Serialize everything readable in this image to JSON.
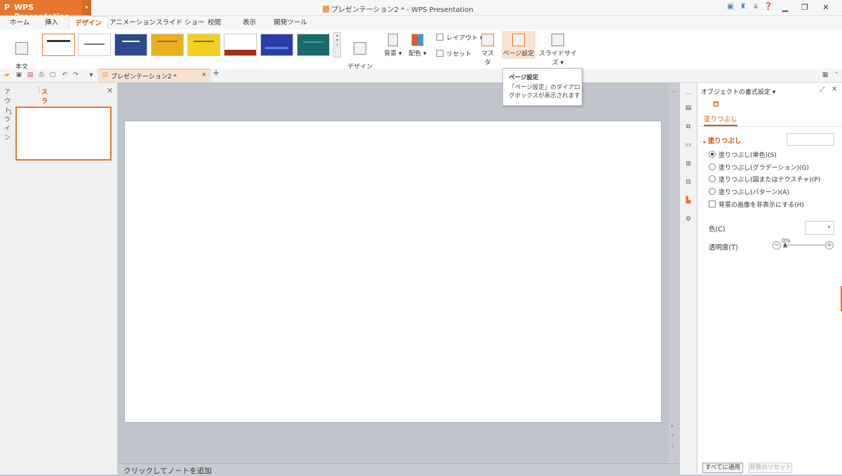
{
  "app": {
    "name": "WPS Presentation",
    "logo": "P",
    "dropdown": "▾"
  },
  "window": {
    "title": "プレゼンテーション2 * - WPS Presentation",
    "min": "▁",
    "restore": "❐",
    "close": "✕"
  },
  "titlebar_icons": [
    "skin-icon",
    "shirt-icon",
    "user-icon",
    "help-icon"
  ],
  "menu_tabs": [
    "ホーム",
    "挿入",
    "デザイン",
    "アニメーション",
    "スライド ショー",
    "校閲",
    "表示",
    "開発ツール"
  ],
  "active_tab": "デザイン",
  "ribbon": {
    "body_template": "本文\nテンプレート",
    "design_template": "デザイン\nテンプレート",
    "background": "背景",
    "color_scheme": "配色",
    "layout": "レイアウト",
    "reset": "リセット",
    "master": "マスタ",
    "page_setup": "ページ設定",
    "slide_size": "スライドサイズ"
  },
  "theme_thumbnails": [
    {
      "name": "theme-1",
      "bg": "#ffffff",
      "accent": "#333333"
    },
    {
      "name": "theme-2",
      "bg": "#ffffff",
      "accent": "#666666"
    },
    {
      "name": "theme-3",
      "bg": "#2c4a8c",
      "accent": "#ffffff"
    },
    {
      "name": "theme-4",
      "bg": "#e8b020",
      "accent": "#c05a10"
    },
    {
      "name": "theme-5",
      "bg": "#f2d020",
      "accent": "#807010"
    },
    {
      "name": "theme-6",
      "bg": "#ffffff",
      "accent": "#a03010"
    },
    {
      "name": "theme-7",
      "bg": "#2a3ea8",
      "accent": "#6080e0"
    },
    {
      "name": "theme-8",
      "bg": "#1a6a6a",
      "accent": "#40a0a0"
    }
  ],
  "tooltip": {
    "title": "ページ設定",
    "body": "「ページ設定」のダイアログボックスが表示されます"
  },
  "document_tab": {
    "label": "プレゼンテーション2 *",
    "close": "×",
    "new": "+"
  },
  "left_panel": {
    "tab_outline": "アウトライン",
    "tab_slide": "スライド",
    "close": "✕",
    "slide_number": "1"
  },
  "notes_placeholder": "クリックしてノートを追加",
  "task_pane": {
    "title": "オブジェクトの書式設定",
    "tab": "塗りつぶし",
    "section": "塗りつぶし",
    "options": [
      {
        "label": "塗りつぶし(単色)(S)",
        "selected": true
      },
      {
        "label": "塗りつぶし(グラデーション)(G)",
        "selected": false
      },
      {
        "label": "塗りつぶし(図またはテクスチャ)(P)",
        "selected": false
      },
      {
        "label": "塗りつぶし(パターン)(A)",
        "selected": false
      }
    ],
    "hide_bg_graphics": "背景の画像を非表示にする(H)",
    "color_label": "色(C)",
    "transparency_label": "透明度(T)",
    "transparency_value": "0%",
    "apply_all": "すべてに適用",
    "reset_background": "背景のリセット"
  },
  "colors": {
    "accent": "#e8772e",
    "accent_text": "#c65a12"
  }
}
